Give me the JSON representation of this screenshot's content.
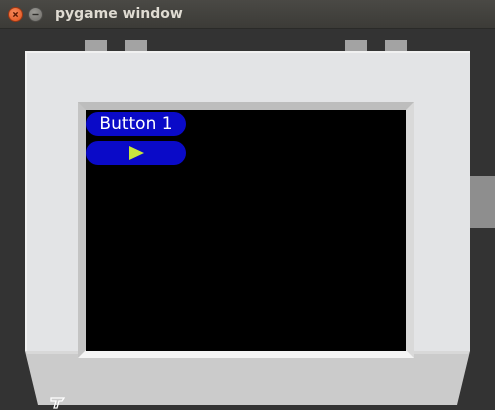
{
  "window": {
    "title": "pygame window",
    "controls": [
      "close",
      "minimize"
    ]
  },
  "screen": {
    "buttons": [
      {
        "label": "Button 1"
      },
      {
        "label": "",
        "icon": "play-icon"
      }
    ]
  },
  "colors": {
    "titlebar": "#3c3b37",
    "title_text": "#dfdbd2",
    "close_button": "#e2521a",
    "device_shell": "#e3e4e6",
    "screen_bg": "#000000",
    "button_bg": "#0a0ac8",
    "button_text": "#ffffff",
    "play_icon": "#c8e63c"
  },
  "device": {
    "logo_icon": "device-logo-icon"
  }
}
